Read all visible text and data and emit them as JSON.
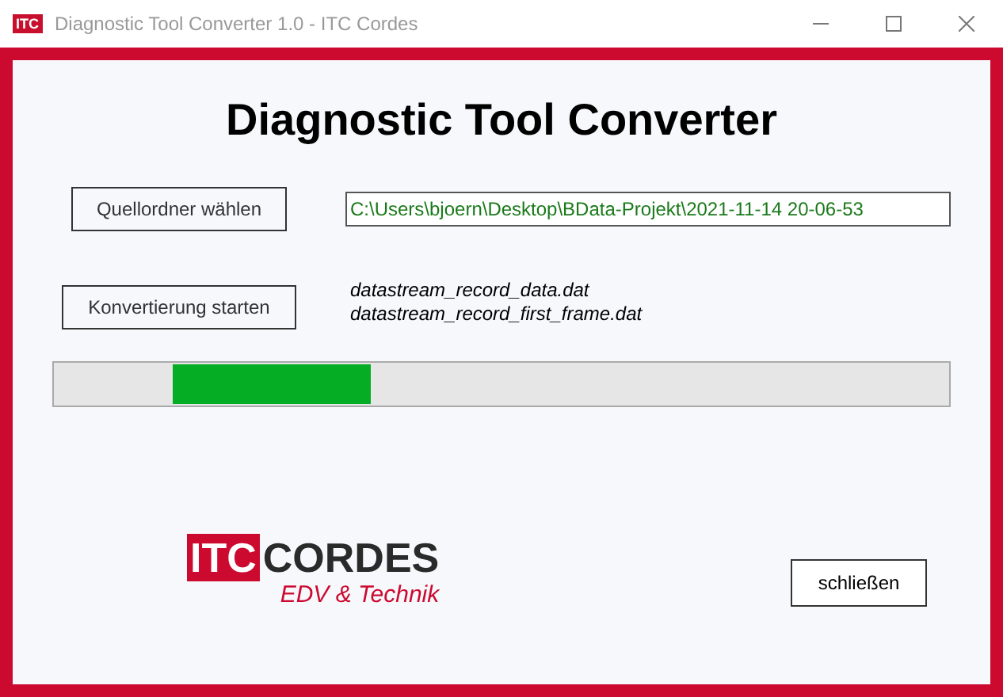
{
  "window": {
    "title": "Diagnostic Tool Converter 1.0 - ITC Cordes",
    "app_icon_text": "ITC"
  },
  "heading": "Diagnostic Tool Converter",
  "folder_button": "Quellordner wählen",
  "folder_path": "C:\\Users\\bjoern\\Desktop\\BData-Projekt\\2021-11-14 20-06-53",
  "convert_button": "Konvertierung starten",
  "files": [
    "datastream_record_data.dat",
    "datastream_record_first_frame.dat"
  ],
  "progress": {
    "level": 0.22
  },
  "logo": {
    "left": "ITC",
    "right": "CORDES",
    "tagline": "EDV & Technik"
  },
  "close_button": "schließen"
}
